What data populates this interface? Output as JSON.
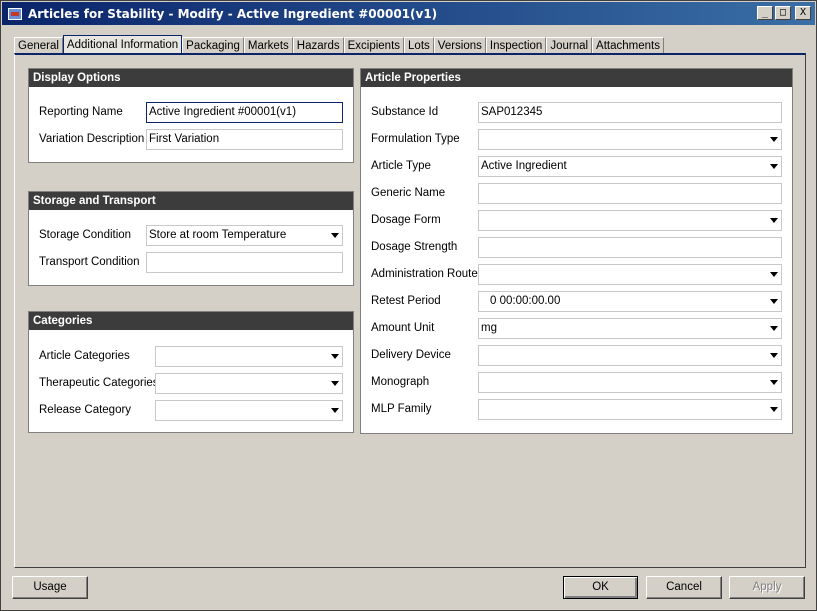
{
  "window": {
    "title": "Articles for Stability - Modify - Active Ingredient #00001(v1)",
    "minimize": "_",
    "maximize": "□",
    "close": "X"
  },
  "tabs": [
    "General",
    "Additional Information",
    "Packaging",
    "Markets",
    "Hazards",
    "Excipients",
    "Lots",
    "Versions",
    "Inspection",
    "Journal",
    "Attachments"
  ],
  "display_options": {
    "title": "Display Options",
    "reporting_name_label": "Reporting Name",
    "reporting_name_value": "Active Ingredient #00001(v1)",
    "variation_description_label": "Variation Description",
    "variation_description_value": "First Variation"
  },
  "storage": {
    "title": "Storage and Transport",
    "storage_condition_label": "Storage Condition",
    "storage_condition_value": "Store at room Temperature",
    "transport_condition_label": "Transport Condition",
    "transport_condition_value": ""
  },
  "categories": {
    "title": "Categories",
    "article_categories_label": "Article Categories",
    "therapeutic_categories_label": "Therapeutic Categories",
    "release_category_label": "Release Category"
  },
  "article_properties": {
    "title": "Article Properties",
    "substance_id_label": "Substance Id",
    "substance_id_value": "SAP012345",
    "formulation_type_label": "Formulation Type",
    "formulation_type_value": "",
    "article_type_label": "Article Type",
    "article_type_value": "Active Ingredient",
    "generic_name_label": "Generic Name",
    "generic_name_value": "",
    "dosage_form_label": "Dosage Form",
    "dosage_form_value": "",
    "dosage_strength_label": "Dosage Strength",
    "dosage_strength_value": "",
    "administration_route_label": "Administration Route",
    "administration_route_value": "",
    "retest_period_label": "Retest Period",
    "retest_period_value": "0 00:00:00.00",
    "amount_unit_label": "Amount Unit",
    "amount_unit_value": "mg",
    "delivery_device_label": "Delivery Device",
    "delivery_device_value": "",
    "monograph_label": "Monograph",
    "monograph_value": "",
    "mlp_family_label": "MLP Family",
    "mlp_family_value": ""
  },
  "buttons": {
    "usage": "Usage",
    "ok": "OK",
    "cancel": "Cancel",
    "apply": "Apply"
  }
}
